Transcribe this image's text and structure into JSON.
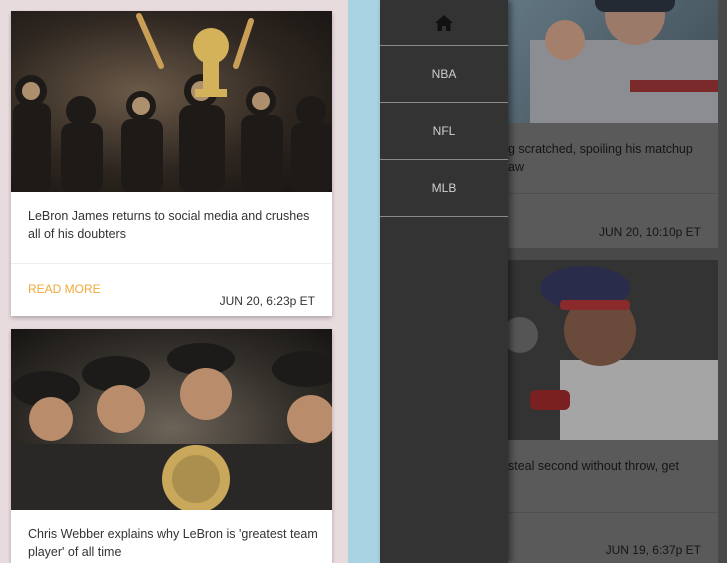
{
  "drawer": {
    "items": [
      {
        "icon": "home-icon"
      },
      {
        "label": "NBA"
      },
      {
        "label": "NFL"
      },
      {
        "label": "MLB"
      }
    ]
  },
  "left_cards": [
    {
      "headline": "LeBron James returns to social media and crushes all of his doubters",
      "read_more": "READ MORE",
      "date": "JUN 20, 6:23p ET"
    },
    {
      "headline": "Chris Webber explains why LeBron is 'greatest team player' of all time"
    }
  ],
  "right_cards": [
    {
      "headline_line1": "g scratched, spoiling his matchup",
      "headline_line2": "aw",
      "date": "JUN 20, 10:10p ET"
    },
    {
      "headline_line1": "steal second without throw, get",
      "date": "JUN 19, 6:37p ET"
    }
  ],
  "colors": {
    "accent": "#f0a93a",
    "drawer_bg": "#333333",
    "gutter": "#a9d3e2"
  }
}
